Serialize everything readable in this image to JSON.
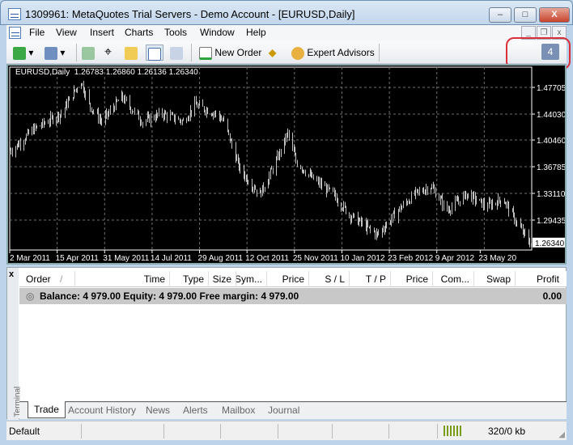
{
  "window": {
    "title": "1309961: MetaQuotes Trial Servers - Demo Account - [EURUSD,Daily]",
    "minimize": "–",
    "maximize": "□",
    "close": "X"
  },
  "menu": [
    "File",
    "View",
    "Insert",
    "Charts",
    "Tools",
    "Window",
    "Help"
  ],
  "toolbar": {
    "new_order": "New Order",
    "expert_advisors": "Expert Advisors",
    "notifications_count": "4"
  },
  "chart": {
    "symbol_label": "EURUSD,Daily",
    "ohlc": "1.26783 1.26860 1.26136 1.26340",
    "price_ticks": [
      "1.47705",
      "1.44030",
      "1.40460",
      "1.36785",
      "1.33110",
      "1.29435"
    ],
    "current_price": "1.26340",
    "date_ticks": [
      "2 Mar 2011",
      "15 Apr 2011",
      "31 May 2011",
      "14 Jul 2011",
      "29 Aug 2011",
      "12 Oct 2011",
      "25 Nov 2011",
      "10 Jan 2012",
      "23 Feb 2012",
      "9 Apr 2012",
      "23 May 20"
    ],
    "price_path": [
      [
        "2011-03-04",
        1.391
      ],
      [
        "2011-03-22",
        1.419
      ],
      [
        "2011-04-15",
        1.441
      ],
      [
        "2011-05-02",
        1.486
      ],
      [
        "2011-05-09",
        1.453
      ],
      [
        "2011-05-20",
        1.43
      ],
      [
        "2011-06-06",
        1.464
      ],
      [
        "2011-06-24",
        1.43
      ],
      [
        "2011-07-11",
        1.441
      ],
      [
        "2011-07-29",
        1.43
      ],
      [
        "2011-08-08",
        1.453
      ],
      [
        "2011-08-26",
        1.441
      ],
      [
        "2011-09-02",
        1.43
      ],
      [
        "2011-09-16",
        1.363
      ],
      [
        "2011-10-03",
        1.33
      ],
      [
        "2011-10-17",
        1.375
      ],
      [
        "2011-10-27",
        1.414
      ],
      [
        "2011-11-03",
        1.375
      ],
      [
        "2011-11-17",
        1.352
      ],
      [
        "2011-12-05",
        1.33
      ],
      [
        "2011-12-19",
        1.302
      ],
      [
        "2012-01-12",
        1.274
      ],
      [
        "2012-01-30",
        1.308
      ],
      [
        "2012-02-13",
        1.33
      ],
      [
        "2012-02-27",
        1.341
      ],
      [
        "2012-03-12",
        1.308
      ],
      [
        "2012-03-29",
        1.33
      ],
      [
        "2012-04-15",
        1.313
      ],
      [
        "2012-04-29",
        1.324
      ],
      [
        "2012-05-13",
        1.285
      ],
      [
        "2012-05-22",
        1.263
      ]
    ],
    "colors": {
      "background": "#000000",
      "bars": "#c0c0c0",
      "grid": "#6f6f6f"
    }
  },
  "terminal": {
    "close": "x",
    "label": "Terminal",
    "columns": [
      "Order",
      "Time",
      "Type",
      "Size",
      "Sym...",
      "Price",
      "S / L",
      "T / P",
      "Price",
      "Com...",
      "Swap",
      "Profit"
    ],
    "sort_indicator": "/",
    "balance_row": "Balance: 4 979.00  Equity: 4 979.00  Free margin: 4 979.00",
    "profit": "0.00",
    "tabs": [
      "Trade",
      "Account History",
      "News",
      "Alerts",
      "Mailbox",
      "Journal"
    ]
  },
  "status": {
    "profile": "Default",
    "traffic": "320/0 kb"
  }
}
